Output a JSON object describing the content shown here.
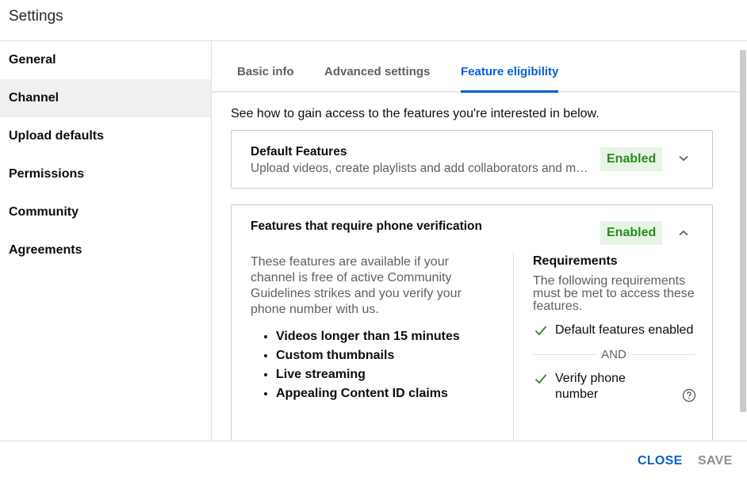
{
  "header": {
    "title": "Settings"
  },
  "sidebar": {
    "items": [
      {
        "label": "General",
        "active": false
      },
      {
        "label": "Channel",
        "active": true
      },
      {
        "label": "Upload defaults",
        "active": false
      },
      {
        "label": "Permissions",
        "active": false
      },
      {
        "label": "Community",
        "active": false
      },
      {
        "label": "Agreements",
        "active": false
      }
    ]
  },
  "tabs": [
    {
      "label": "Basic info",
      "active": false
    },
    {
      "label": "Advanced settings",
      "active": false
    },
    {
      "label": "Feature eligibility",
      "active": true
    }
  ],
  "main": {
    "intro": "See how to gain access to the features you're interested in below.",
    "cards": [
      {
        "title": "Default Features",
        "subtitle": "Upload videos, create playlists and add collaborators and more",
        "status": "Enabled",
        "expanded": false,
        "toggle_icon": "chevron-down-icon"
      },
      {
        "title": "Features that require phone verification",
        "status": "Enabled",
        "expanded": true,
        "toggle_icon": "chevron-up-icon",
        "description": "These features are available if your channel is free of active Community Guidelines strikes and you verify your phone number with us.",
        "features": [
          "Videos longer than 15 minutes",
          "Custom thumbnails",
          "Live streaming",
          "Appealing Content ID claims"
        ],
        "requirements": {
          "title": "Requirements",
          "description": "The following requirements must be met to access these features.",
          "items": [
            {
              "label": "Default features enabled",
              "met": true,
              "icon": "check-icon"
            },
            {
              "label": "Verify phone number",
              "met": true,
              "icon": "check-icon",
              "help_icon": "help-circle-icon"
            }
          ],
          "separator": "AND"
        }
      }
    ]
  },
  "footer": {
    "close_label": "CLOSE",
    "save_label": "SAVE"
  },
  "colors": {
    "accent": "#065fd4",
    "enabled_text": "#2b8a1e",
    "enabled_bg": "#e6f4e6",
    "disabled_button": "#909090"
  }
}
